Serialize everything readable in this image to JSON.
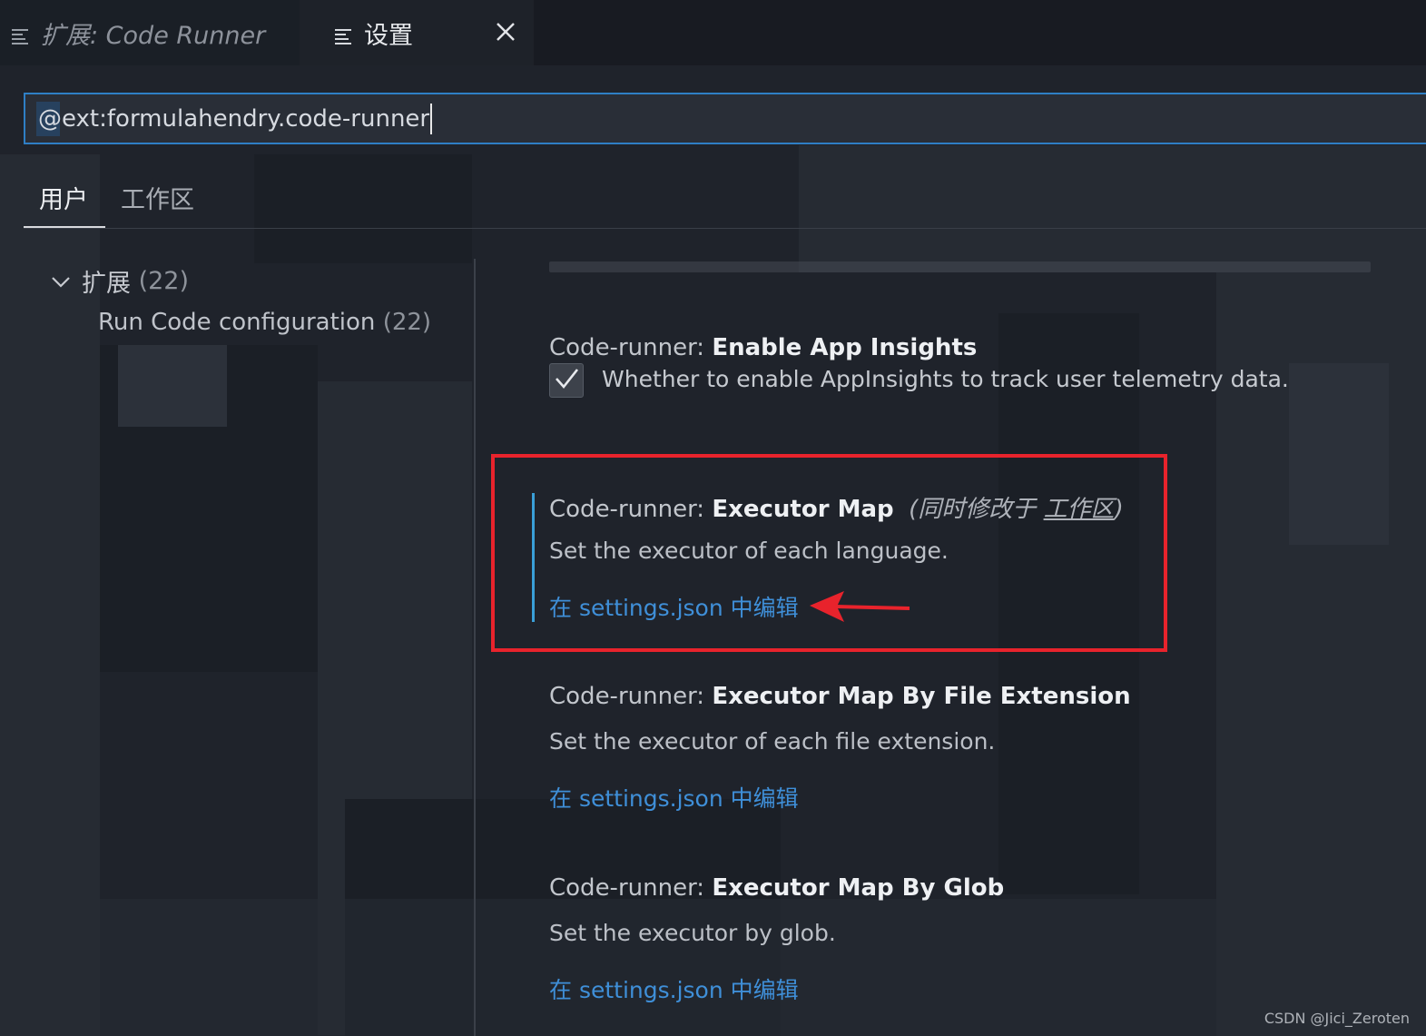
{
  "tabs": [
    {
      "label": "扩展: Code Runner",
      "active": false
    },
    {
      "label": "设置",
      "active": true
    }
  ],
  "search": {
    "value": "@ext:formulahendry.code-runner"
  },
  "scope_tabs": {
    "user": "用户",
    "workspace": "工作区"
  },
  "toc": {
    "group_label": "扩展",
    "group_count": "(22)",
    "item_label": "Run Code configuration",
    "item_count": "(22)"
  },
  "settings": [
    {
      "category": "Code-runner: ",
      "name": "Enable App Insights",
      "checkbox_checked": true,
      "description": "Whether to enable AppInsights to track user telemetry data."
    },
    {
      "category": "Code-runner: ",
      "name": "Executor Map",
      "modified_prefix": "(同时修改于 ",
      "modified_link": "工作区",
      "modified_suffix": ")",
      "description": "Set the executor of each language.",
      "link": "在 settings.json 中编辑"
    },
    {
      "category": "Code-runner: ",
      "name": "Executor Map By File Extension",
      "description": "Set the executor of each file extension.",
      "link": "在 settings.json 中编辑"
    },
    {
      "category": "Code-runner: ",
      "name": "Executor Map By Glob",
      "description": "Set the executor by glob.",
      "link": "在 settings.json 中编辑"
    }
  ],
  "watermark": "CSDN @Jici_Zeroten",
  "colors": {
    "accent": "#3f8fd8",
    "highlight": "#e8232c",
    "focus": "#3a9fd8"
  }
}
